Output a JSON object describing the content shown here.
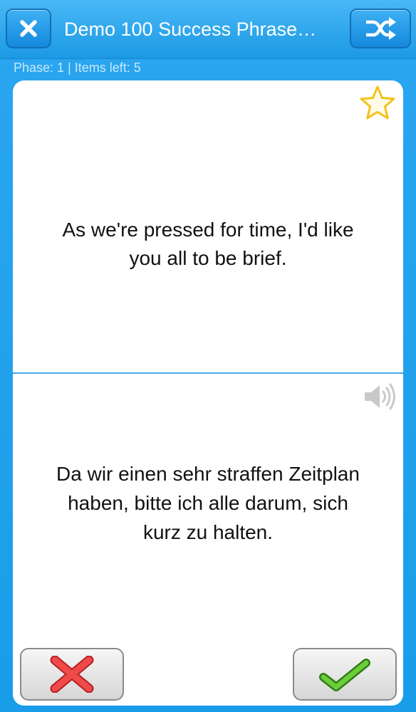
{
  "nav": {
    "title": "Demo 100 Success Phrase…",
    "close_icon": "close-x-icon",
    "shuffle_icon": "shuffle-icon"
  },
  "status": {
    "text": "Phase: 1 | Items left: 5"
  },
  "card": {
    "prompt_line1": "As we're pressed for time, I'd like",
    "prompt_line2": "you all to be brief.",
    "answer_line1": "Da wir einen sehr straffen Zeitplan",
    "answer_line2": "haben, bitte ich alle darum, sich",
    "answer_line3": "kurz zu halten.",
    "favorite_icon": "star-icon",
    "audio_icon": "speaker-icon"
  },
  "actions": {
    "wrong_icon": "red-x-icon",
    "right_icon": "green-checkmark-icon"
  },
  "colors": {
    "accent": "#1a9de9",
    "star": "#f3c31b",
    "wrong": "#e23a3a",
    "right": "#4fb02e"
  }
}
